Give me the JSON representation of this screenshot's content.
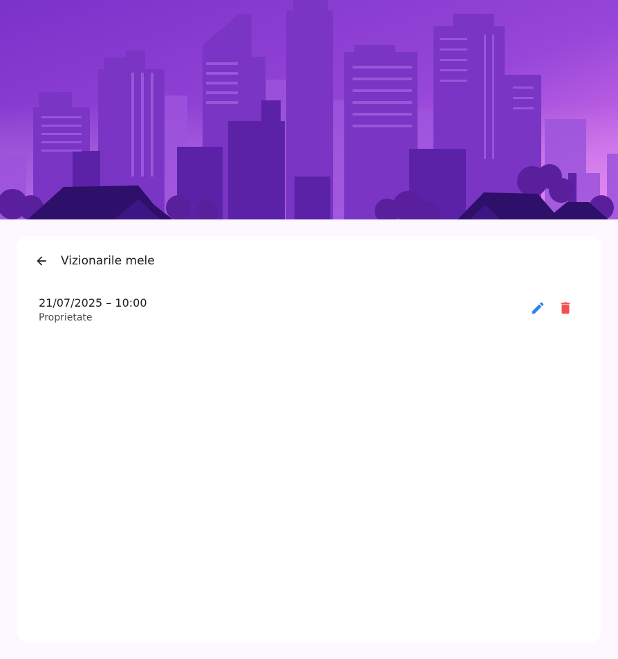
{
  "header": {
    "title": "Vizionarile mele",
    "back_icon": "arrow-back-icon"
  },
  "viewings": [
    {
      "datetime": "21/07/2025 – 10:00",
      "property": "Proprietate",
      "edit_icon": "pencil-icon",
      "delete_icon": "trash-icon"
    }
  ],
  "colors": {
    "edit": "#2f80ed",
    "delete": "#f44f4f",
    "card": "#ffffff",
    "background": "#fdf7ff",
    "hero_accent": "#8a3fd6"
  }
}
